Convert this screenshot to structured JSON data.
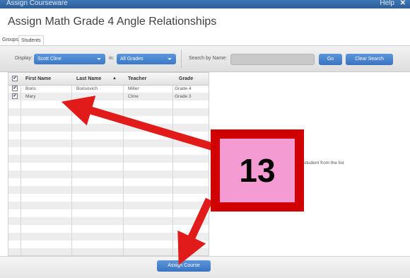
{
  "window": {
    "title": "Assign Courseware",
    "help_label": "Help",
    "close_glyph": "✕"
  },
  "dialog": {
    "title": "Assign Math Grade 4 Angle Relationships"
  },
  "tabs": [
    {
      "label": "Groups",
      "active": false
    },
    {
      "label": "Students",
      "active": true
    }
  ],
  "filters": {
    "display_label": "Display:",
    "display_value": "Scott Cline",
    "in_label": "in:",
    "grade_value": "All Grades",
    "search_label": "Search by Name:",
    "search_value": "",
    "go_label": "Go",
    "clear_label": "Clear Search"
  },
  "table": {
    "columns": [
      "First Name",
      "Last Name",
      "Teacher",
      "Grade"
    ],
    "sort_column": "Last Name",
    "header_checked": true,
    "rows": [
      {
        "checked": true,
        "first": "Boris",
        "last": "Borisovich",
        "teacher": "Miller",
        "grade": "Grade 4"
      },
      {
        "checked": true,
        "first": "Mary",
        "last": "",
        "teacher": "Cline",
        "grade": "Grade 3"
      }
    ]
  },
  "hint_text": "student from the list",
  "assign_button": "Assign Course",
  "annotation": {
    "step_number": "13",
    "arrow_color": "#e11a1a",
    "badge_color": "#d00000",
    "badge_fill": "#f49bd3"
  },
  "colors": {
    "accent_blue": "#3b78c6",
    "title_bar": "#2d5e98"
  }
}
